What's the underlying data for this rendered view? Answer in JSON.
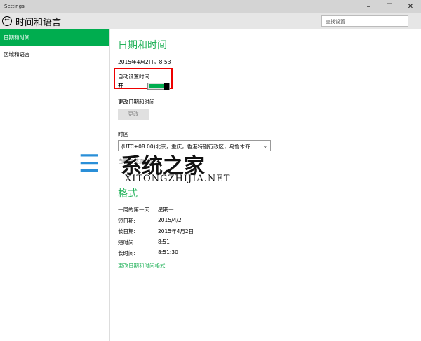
{
  "window": {
    "title": "Settings",
    "min": "–",
    "max": "☐",
    "close": "✕"
  },
  "header": {
    "back": "←",
    "title": "时间和语言",
    "search_placeholder": "查找设置"
  },
  "sidebar": {
    "items": [
      {
        "label": "日期和时间"
      },
      {
        "label": "区域和语言"
      }
    ]
  },
  "main": {
    "title": "日期和时间",
    "current": "2015年4月2日，8:53",
    "auto_time_label": "自动设置时间",
    "auto_time_state": "开",
    "auto_time_on": true,
    "change_label": "更改日期和时间",
    "change_button": "更改",
    "tz_label": "时区",
    "tz_value": "(UTC+08:00)北京，重庆，香港特别行政区，乌鲁木齐",
    "dst_label": "自动调整夏令时",
    "format_title": "格式",
    "formats": [
      {
        "k": "一周的第一天:",
        "v": "星期一"
      },
      {
        "k": "短日期:",
        "v": "2015/4/2"
      },
      {
        "k": "长日期:",
        "v": "2015年4月2日"
      },
      {
        "k": "短时间:",
        "v": "8:51"
      },
      {
        "k": "长时间:",
        "v": "8:51:30"
      }
    ],
    "format_link": "更改日期和时间格式"
  },
  "watermark": {
    "cn": "系统之家",
    "en": "XITONGZHIJIA.NET"
  }
}
